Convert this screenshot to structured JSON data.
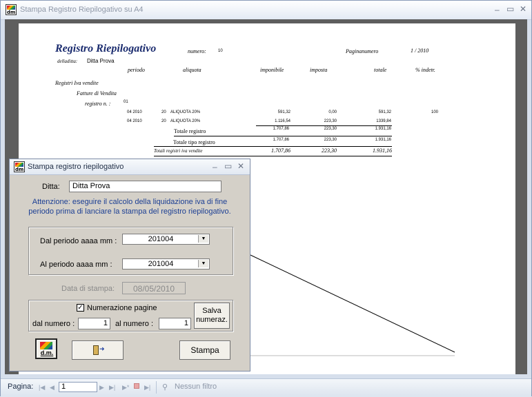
{
  "main_window": {
    "title": "Stampa Registro Riepilogativo su A4",
    "minimize": "‒",
    "maximize": "▭",
    "close": "✕"
  },
  "report": {
    "title": "Registro Riepilogativo",
    "numero_label": "numero:",
    "numero_value": "10",
    "pagina_label": "Paginanumero",
    "pagina_value": "1  /  2010",
    "ditta_label": "delladitta:",
    "ditta_value": "Ditta Prova",
    "columns": {
      "periodo": "periodo",
      "aliquota": "aliquota",
      "imponibile": "imponibile",
      "imposta": "imposta",
      "totale": "totale",
      "indetr": "% indetr."
    },
    "section1": "Registri Iva vendite",
    "section2": "Fatture di Vendita",
    "registro_label": "registro n. :",
    "registro_value": "01",
    "rows": [
      {
        "periodo": "04 2010",
        "aliq_code": "20",
        "aliq_desc": "ALIQUOTA 20%",
        "imponibile": "591,32",
        "imposta": "0,00",
        "totale": "591,32",
        "indetr": "100"
      },
      {
        "periodo": "04 2010",
        "aliq_code": "20",
        "aliq_desc": "ALIQUOTA 20%",
        "imponibile": "1.116,54",
        "imposta": "223,30",
        "totale": "1339,84",
        "indetr": ""
      }
    ],
    "totale_registro": {
      "label": "Totale registro",
      "imponibile": "1.707,86",
      "imposta": "223,30",
      "totale": "1.931,16"
    },
    "totale_tipo": {
      "label": "Totale tipo registro",
      "imponibile": "1.707,86",
      "imposta": "223,30",
      "totale": "1.931,16"
    },
    "totali_vendite": {
      "label": "Totali registri iva vendite",
      "imponibile": "1.707,86",
      "imposta": "223,30",
      "totale": "1.931,16"
    }
  },
  "status_bar": {
    "pagina_label": "Pagina:",
    "pagina_value": "1",
    "filter": "Nessun filtro"
  },
  "dialog": {
    "title": "Stampa registro riepilogativo",
    "minimize": "‒",
    "maximize": "▭",
    "close": "✕",
    "ditta_label": "Ditta:",
    "ditta_value": "Ditta Prova",
    "warning_line1": "Attenzione: eseguire il calcolo della liquidazione iva di fine",
    "warning_line2": "periodo prima di lanciare la stampa del registro riepilogativo.",
    "dal_periodo_label": "Dal periodo aaaa mm :",
    "dal_periodo_value": "201004",
    "al_periodo_label": "Al periodo aaaa mm :",
    "al_periodo_value": "201004",
    "data_stampa_label": "Data di stampa:",
    "data_stampa_value": "08/05/2010",
    "numerazione_label": "Numerazione pagine",
    "numerazione_checked": true,
    "dal_numero_label": "dal numero :",
    "dal_numero_value": "1",
    "al_numero_label": "al numero :",
    "al_numero_value": "1",
    "salva_line1": "Salva",
    "salva_line2": "numeraz.",
    "stampa_label": "Stampa",
    "logo_text": "d.m."
  },
  "icons": [
    "app-icon",
    "exit-door-icon",
    "filter-icon",
    "checkbox-check-icon",
    "dropdown-arrow-icon"
  ]
}
